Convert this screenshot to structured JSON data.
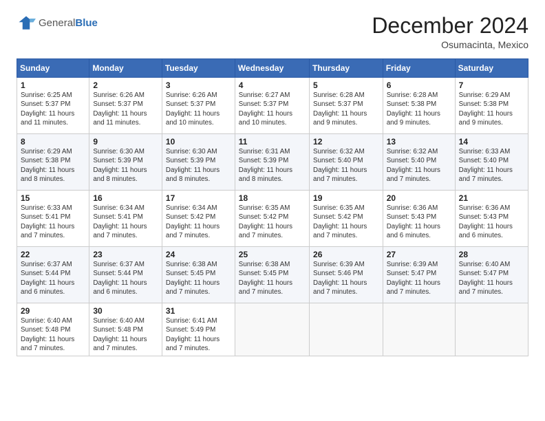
{
  "header": {
    "logo_general": "General",
    "logo_blue": "Blue",
    "month_title": "December 2024",
    "location": "Osumacinta, Mexico"
  },
  "days_of_week": [
    "Sunday",
    "Monday",
    "Tuesday",
    "Wednesday",
    "Thursday",
    "Friday",
    "Saturday"
  ],
  "weeks": [
    [
      {
        "day": "1",
        "info": "Sunrise: 6:25 AM\nSunset: 5:37 PM\nDaylight: 11 hours and 11 minutes."
      },
      {
        "day": "2",
        "info": "Sunrise: 6:26 AM\nSunset: 5:37 PM\nDaylight: 11 hours and 11 minutes."
      },
      {
        "day": "3",
        "info": "Sunrise: 6:26 AM\nSunset: 5:37 PM\nDaylight: 11 hours and 10 minutes."
      },
      {
        "day": "4",
        "info": "Sunrise: 6:27 AM\nSunset: 5:37 PM\nDaylight: 11 hours and 10 minutes."
      },
      {
        "day": "5",
        "info": "Sunrise: 6:28 AM\nSunset: 5:37 PM\nDaylight: 11 hours and 9 minutes."
      },
      {
        "day": "6",
        "info": "Sunrise: 6:28 AM\nSunset: 5:38 PM\nDaylight: 11 hours and 9 minutes."
      },
      {
        "day": "7",
        "info": "Sunrise: 6:29 AM\nSunset: 5:38 PM\nDaylight: 11 hours and 9 minutes."
      }
    ],
    [
      {
        "day": "8",
        "info": "Sunrise: 6:29 AM\nSunset: 5:38 PM\nDaylight: 11 hours and 8 minutes."
      },
      {
        "day": "9",
        "info": "Sunrise: 6:30 AM\nSunset: 5:39 PM\nDaylight: 11 hours and 8 minutes."
      },
      {
        "day": "10",
        "info": "Sunrise: 6:30 AM\nSunset: 5:39 PM\nDaylight: 11 hours and 8 minutes."
      },
      {
        "day": "11",
        "info": "Sunrise: 6:31 AM\nSunset: 5:39 PM\nDaylight: 11 hours and 8 minutes."
      },
      {
        "day": "12",
        "info": "Sunrise: 6:32 AM\nSunset: 5:40 PM\nDaylight: 11 hours and 7 minutes."
      },
      {
        "day": "13",
        "info": "Sunrise: 6:32 AM\nSunset: 5:40 PM\nDaylight: 11 hours and 7 minutes."
      },
      {
        "day": "14",
        "info": "Sunrise: 6:33 AM\nSunset: 5:40 PM\nDaylight: 11 hours and 7 minutes."
      }
    ],
    [
      {
        "day": "15",
        "info": "Sunrise: 6:33 AM\nSunset: 5:41 PM\nDaylight: 11 hours and 7 minutes."
      },
      {
        "day": "16",
        "info": "Sunrise: 6:34 AM\nSunset: 5:41 PM\nDaylight: 11 hours and 7 minutes."
      },
      {
        "day": "17",
        "info": "Sunrise: 6:34 AM\nSunset: 5:42 PM\nDaylight: 11 hours and 7 minutes."
      },
      {
        "day": "18",
        "info": "Sunrise: 6:35 AM\nSunset: 5:42 PM\nDaylight: 11 hours and 7 minutes."
      },
      {
        "day": "19",
        "info": "Sunrise: 6:35 AM\nSunset: 5:42 PM\nDaylight: 11 hours and 7 minutes."
      },
      {
        "day": "20",
        "info": "Sunrise: 6:36 AM\nSunset: 5:43 PM\nDaylight: 11 hours and 6 minutes."
      },
      {
        "day": "21",
        "info": "Sunrise: 6:36 AM\nSunset: 5:43 PM\nDaylight: 11 hours and 6 minutes."
      }
    ],
    [
      {
        "day": "22",
        "info": "Sunrise: 6:37 AM\nSunset: 5:44 PM\nDaylight: 11 hours and 6 minutes."
      },
      {
        "day": "23",
        "info": "Sunrise: 6:37 AM\nSunset: 5:44 PM\nDaylight: 11 hours and 6 minutes."
      },
      {
        "day": "24",
        "info": "Sunrise: 6:38 AM\nSunset: 5:45 PM\nDaylight: 11 hours and 7 minutes."
      },
      {
        "day": "25",
        "info": "Sunrise: 6:38 AM\nSunset: 5:45 PM\nDaylight: 11 hours and 7 minutes."
      },
      {
        "day": "26",
        "info": "Sunrise: 6:39 AM\nSunset: 5:46 PM\nDaylight: 11 hours and 7 minutes."
      },
      {
        "day": "27",
        "info": "Sunrise: 6:39 AM\nSunset: 5:47 PM\nDaylight: 11 hours and 7 minutes."
      },
      {
        "day": "28",
        "info": "Sunrise: 6:40 AM\nSunset: 5:47 PM\nDaylight: 11 hours and 7 minutes."
      }
    ],
    [
      {
        "day": "29",
        "info": "Sunrise: 6:40 AM\nSunset: 5:48 PM\nDaylight: 11 hours and 7 minutes."
      },
      {
        "day": "30",
        "info": "Sunrise: 6:40 AM\nSunset: 5:48 PM\nDaylight: 11 hours and 7 minutes."
      },
      {
        "day": "31",
        "info": "Sunrise: 6:41 AM\nSunset: 5:49 PM\nDaylight: 11 hours and 7 minutes."
      },
      null,
      null,
      null,
      null
    ]
  ]
}
